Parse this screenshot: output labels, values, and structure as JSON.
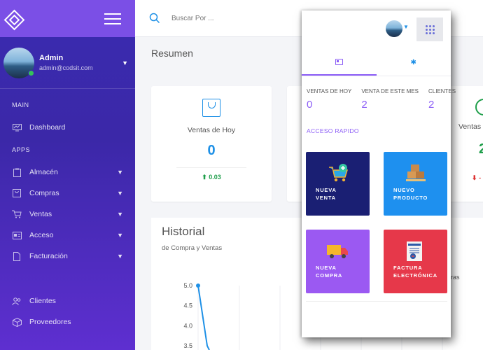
{
  "sidebar": {
    "user": {
      "name": "Admin",
      "email": "admin@codsit.com"
    },
    "sections": {
      "main": "MAIN",
      "apps": "APPS"
    },
    "items": [
      {
        "label": "Dashboard",
        "icon": "dashboard-icon"
      },
      {
        "label": "Almacén",
        "icon": "clipboard-icon"
      },
      {
        "label": "Compras",
        "icon": "bag-icon"
      },
      {
        "label": "Ventas",
        "icon": "cart-icon"
      },
      {
        "label": "Acceso",
        "icon": "id-card-icon"
      },
      {
        "label": "Facturación",
        "icon": "document-icon"
      },
      {
        "label": "Clientes",
        "icon": "users-icon"
      },
      {
        "label": "Proveedores",
        "icon": "box-icon"
      }
    ]
  },
  "topbar": {
    "search_placeholder": "Buscar Por ..."
  },
  "main": {
    "title": "Resumen",
    "cards": [
      {
        "label": "Ventas de Hoy",
        "value": "0",
        "trend": "0.03"
      },
      {
        "label": "Ventas p",
        "value": "2",
        "trend": "-"
      }
    ],
    "history": {
      "title": "Historial",
      "subtitle": "de Compra y Ventas",
      "legend_partial": "pras"
    }
  },
  "chart_data": {
    "type": "line",
    "title": "",
    "y_ticks": [
      "5.0",
      "4.5",
      "4.0",
      "3.5"
    ],
    "ylim": [
      3.5,
      5.0
    ],
    "series": [
      {
        "values": [
          5.0,
          3.5
        ]
      }
    ]
  },
  "panel": {
    "stats": [
      {
        "label": "VENTAS DE HOY",
        "value": "0"
      },
      {
        "label": "VENTA DE ESTE MES",
        "value": "2"
      },
      {
        "label": "CLIENTES",
        "value": "2"
      }
    ],
    "quick_access_title": "ACCESO RAPIDO",
    "tiles": [
      {
        "label": "NUEVA\nVENTA",
        "color": "#1a1f73"
      },
      {
        "label": "NUEVO\nPRODUCTO",
        "color": "#1e90ef"
      },
      {
        "label": "NUEVA\nCOMPRA",
        "color": "#9b59f2"
      },
      {
        "label": "FACTURA\nELECTRÓNICA",
        "color": "#e6384a"
      }
    ]
  }
}
